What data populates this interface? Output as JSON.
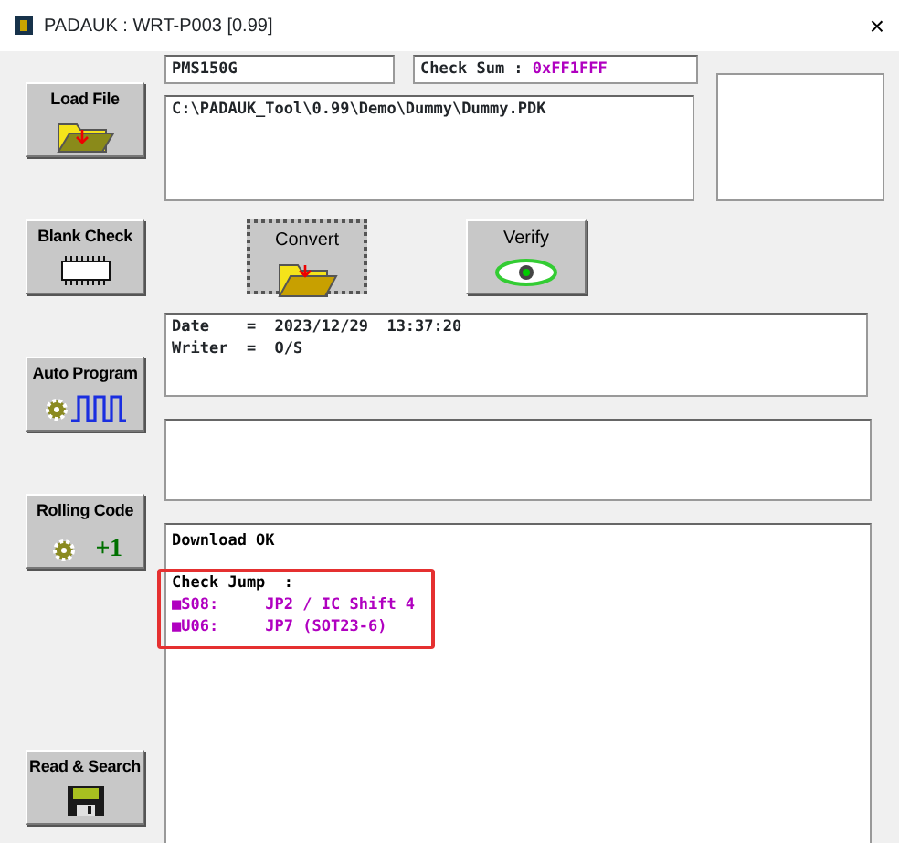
{
  "window": {
    "title": "PADAUK : WRT-P003 [0.99]",
    "close": "×"
  },
  "side_buttons": [
    {
      "label": "Load File",
      "kind": "folder"
    },
    {
      "label": "Blank Check",
      "kind": "chip"
    },
    {
      "label": "Auto Program",
      "kind": "pulse"
    },
    {
      "label": "Rolling Code",
      "kind": "rolling",
      "badge": "+1"
    },
    {
      "label": "Read & Search",
      "kind": "floppy"
    }
  ],
  "ic_field": {
    "value": "PMS150G"
  },
  "checksum": {
    "label": "Check Sum : ",
    "value": "0xFF1FFF"
  },
  "path_box": {
    "value": "C:\\PADAUK_Tool\\0.99\\Demo\\Dummy\\Dummy.PDK"
  },
  "action_buttons": [
    {
      "label": "Convert",
      "kind": "convert",
      "pressed": true
    },
    {
      "label": "Verify",
      "kind": "eye",
      "pressed": false
    }
  ],
  "info_lines": [
    "Date    =  2023/12/29  13:37:20",
    "Writer  =  O/S"
  ],
  "log_lines": [
    {
      "text": "Download OK",
      "color": "#000000",
      "gap_after": true,
      "highlighted": false
    },
    {
      "text": "Check Jump  :",
      "color": "#000000",
      "gap_after": false,
      "highlighted": true
    },
    {
      "text": "■S08:     JP2 / IC Shift 4",
      "color": "#b000c0",
      "gap_after": false,
      "highlighted": true
    },
    {
      "text": "■U06:     JP7 (SOT23-6)",
      "color": "#b000c0",
      "gap_after": false,
      "highlighted": true
    }
  ]
}
